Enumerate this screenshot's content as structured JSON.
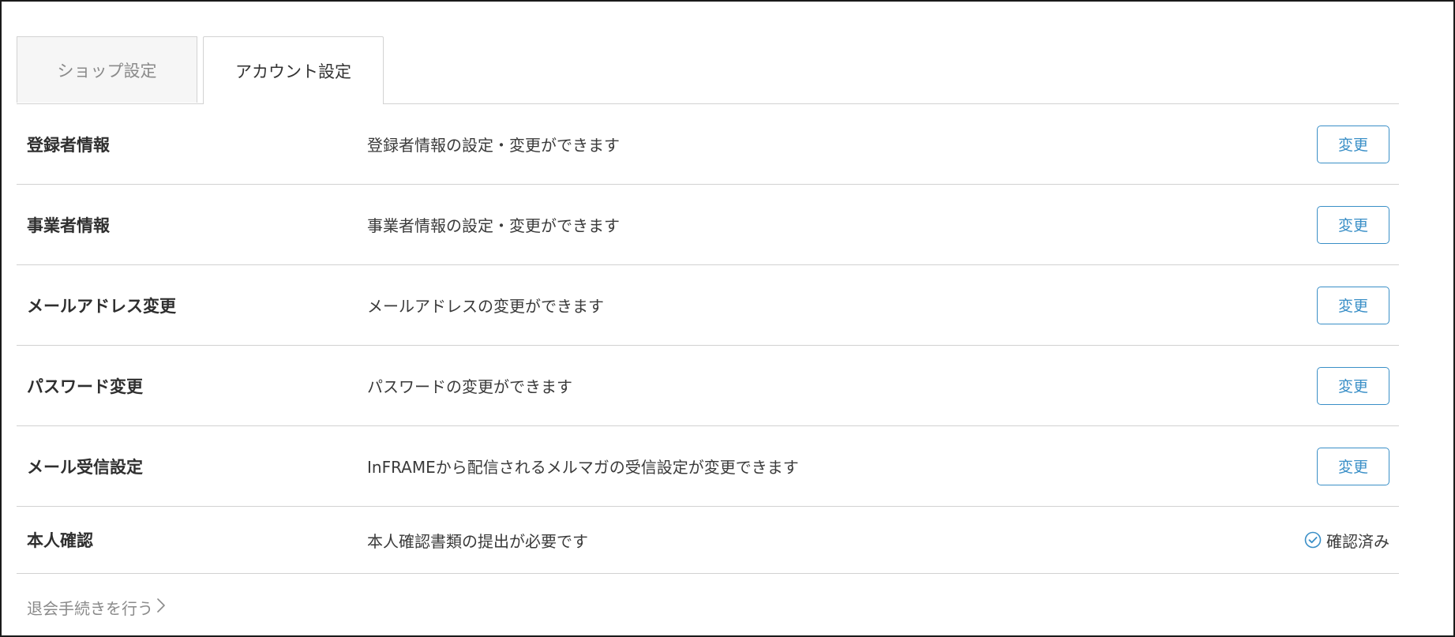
{
  "tabs": [
    {
      "label": "ショップ設定",
      "active": false
    },
    {
      "label": "アカウント設定",
      "active": true
    }
  ],
  "rows": [
    {
      "title": "登録者情報",
      "description": "登録者情報の設定・変更ができます",
      "action": "変更"
    },
    {
      "title": "事業者情報",
      "description": "事業者情報の設定・変更ができます",
      "action": "変更"
    },
    {
      "title": "メールアドレス変更",
      "description": "メールアドレスの変更ができます",
      "action": "変更"
    },
    {
      "title": "パスワード変更",
      "description": "パスワードの変更ができます",
      "action": "変更"
    },
    {
      "title": "メール受信設定",
      "description": "InFRAMEから配信されるメルマガの受信設定が変更できます",
      "action": "変更"
    }
  ],
  "verification": {
    "title": "本人確認",
    "description": "本人確認書類の提出が必要です",
    "status": "確認済み",
    "status_icon": "check-circle-icon"
  },
  "withdraw_link": "退会手続きを行う",
  "withdraw_icon": "chevron-right-icon",
  "colors": {
    "accent": "#3a8fc7",
    "border": "#d2d2d2",
    "muted_text": "#8a8a8a"
  }
}
